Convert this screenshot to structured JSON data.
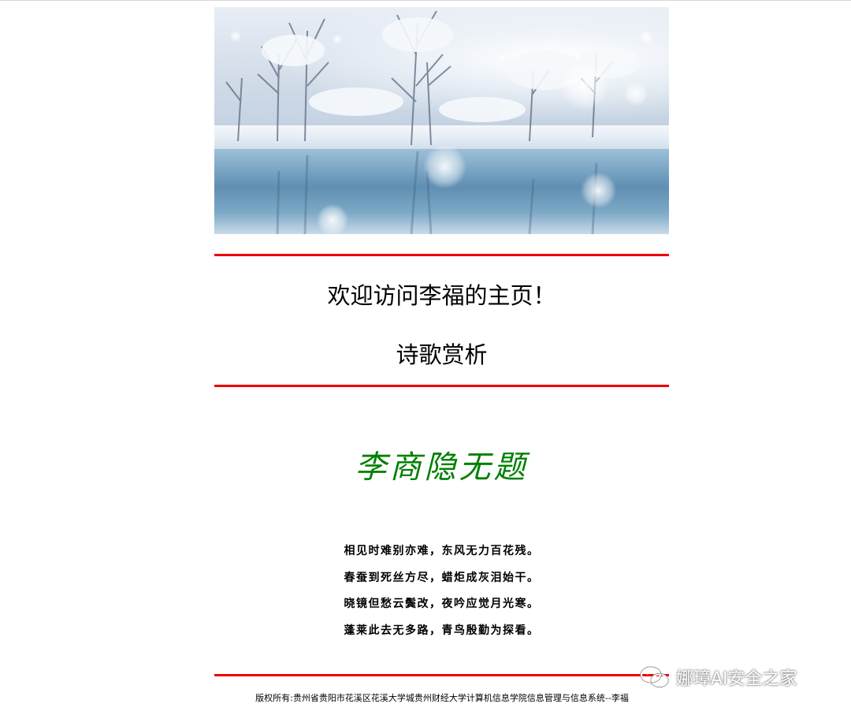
{
  "header": {
    "welcome": "欢迎访问李福的主页！",
    "section": "诗歌赏析"
  },
  "poem": {
    "title": "李商隐无题",
    "lines": [
      "相见时难别亦难，东风无力百花残。",
      "春蚕到死丝方尽，蜡炬成灰泪始干。",
      "晓镜但愁云鬓改，夜吟应觉月光寒。",
      "蓬莱此去无多路，青鸟殷勤为探看。"
    ]
  },
  "footer": {
    "copyright": "版权所有:贵州省贵阳市花溪区花溪大学城贵州财经大学计算机信息学院信息管理与信息系统--李福"
  },
  "watermark": {
    "text": "娜璋AI安全之家"
  },
  "colors": {
    "rule": "#ee0000",
    "poem_title": "#008000"
  },
  "banner": {
    "icon": "snowy-lake-landscape-image"
  }
}
